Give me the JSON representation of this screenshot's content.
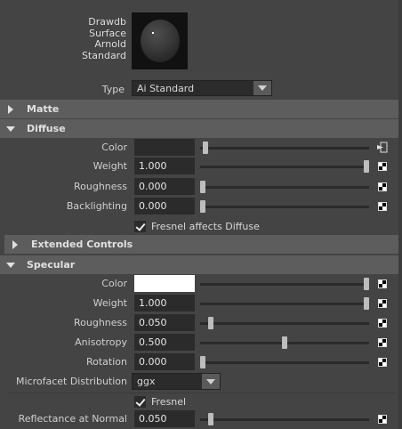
{
  "material": {
    "name_lines": [
      "Drawdb",
      "Surface",
      "Arnold",
      "Standard"
    ]
  },
  "type": {
    "label": "Type",
    "value": "Ai Standard"
  },
  "sections": {
    "matte": "Matte",
    "diffuse": "Diffuse",
    "extended": "Extended Controls",
    "specular": "Specular"
  },
  "diffuse": {
    "color": {
      "label": "Color",
      "value": "#2b2b2b"
    },
    "weight": {
      "label": "Weight",
      "value": "1.000",
      "fraction": 1.0
    },
    "roughness": {
      "label": "Roughness",
      "value": "0.000",
      "fraction": 0.0
    },
    "backlighting": {
      "label": "Backlighting",
      "value": "0.000",
      "fraction": 0.0
    },
    "fresnel_affects": {
      "label": "Fresnel affects Diffuse",
      "checked": true
    }
  },
  "specular": {
    "color": {
      "label": "Color",
      "value": "#ffffff"
    },
    "weight": {
      "label": "Weight",
      "value": "1.000",
      "fraction": 1.0
    },
    "roughness": {
      "label": "Roughness",
      "value": "0.050",
      "fraction": 0.05
    },
    "anisotropy": {
      "label": "Anisotropy",
      "value": "0.500",
      "fraction": 0.5
    },
    "rotation": {
      "label": "Rotation",
      "value": "0.000",
      "fraction": 0.0
    },
    "microfacet": {
      "label": "Microfacet Distribution",
      "value": "ggx"
    },
    "fresnel": {
      "label": "Fresnel",
      "checked": true
    },
    "reflectance": {
      "label": "Reflectance at Normal",
      "value": "0.050",
      "fraction": 0.05
    }
  }
}
